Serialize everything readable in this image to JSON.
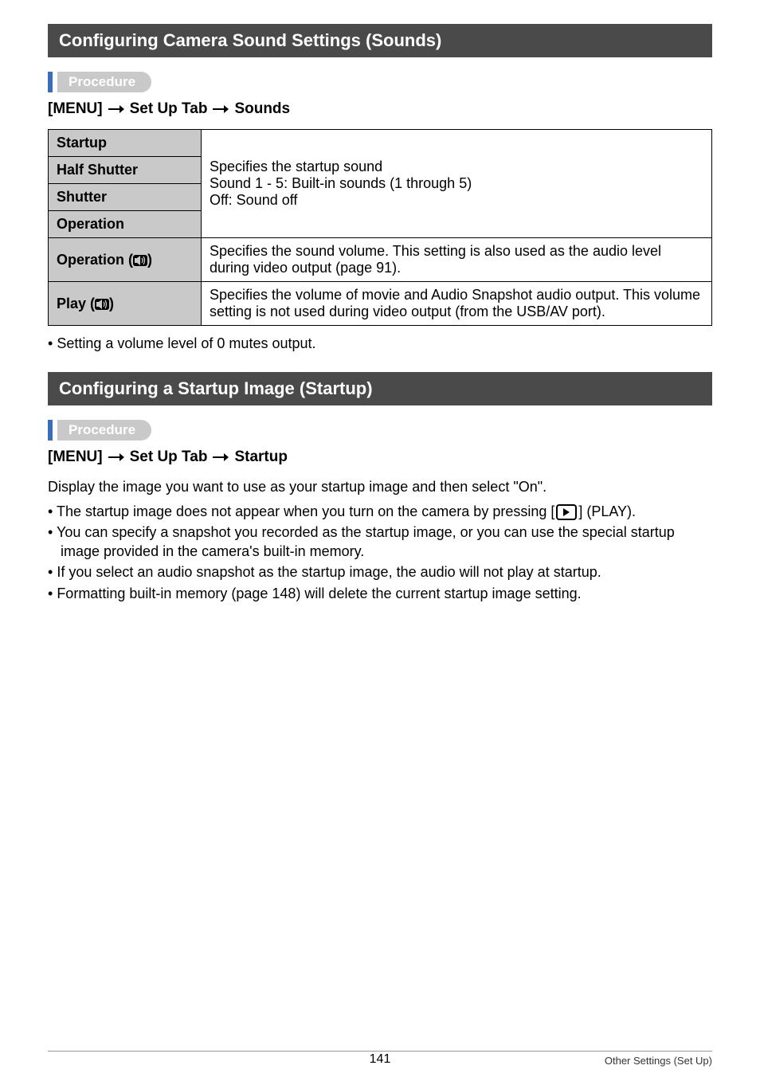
{
  "section1": {
    "heading": "Configuring Camera Sound Settings (Sounds)",
    "procedure_label": "Procedure",
    "menu_part1": "[MENU]",
    "menu_part2": "Set Up Tab",
    "menu_part3": "Sounds",
    "table": {
      "row1": "Startup",
      "row2": "Half Shutter",
      "row3": "Shutter",
      "row4": "Operation",
      "merged_desc_line1": "Specifies the startup sound",
      "merged_desc_line2": "Sound 1 - 5: Built-in sounds (1 through 5)",
      "merged_desc_line3": "Off: Sound off",
      "row5_label": "Operation (",
      "row5_label_close": ")",
      "row5_desc": "Specifies the sound volume. This setting is also used as the audio level during video output (page 91).",
      "row6_label": "Play (",
      "row6_label_close": ")",
      "row6_desc": "Specifies the volume of movie and Audio Snapshot audio output. This volume setting is not used during video output (from the USB/AV port)."
    },
    "note1": "Setting a volume level of 0 mutes output."
  },
  "section2": {
    "heading": "Configuring a Startup Image (Startup)",
    "procedure_label": "Procedure",
    "menu_part1": "[MENU]",
    "menu_part2": "Set Up Tab",
    "menu_part3": "Startup",
    "body": "Display the image you want to use as your startup image and then select \"On\".",
    "b1a": "The startup image does not appear when you turn on the camera by pressing [",
    "b1b": "] (PLAY).",
    "b2": "You can specify a snapshot you recorded as the startup image, or you can use the special startup image provided in the camera's built-in memory.",
    "b3": "If you select an audio snapshot as the startup image, the audio will not play at startup.",
    "b4": "Formatting built-in memory (page 148) will delete the current startup image setting."
  },
  "footer": {
    "page": "141",
    "right": "Other Settings (Set Up)"
  }
}
